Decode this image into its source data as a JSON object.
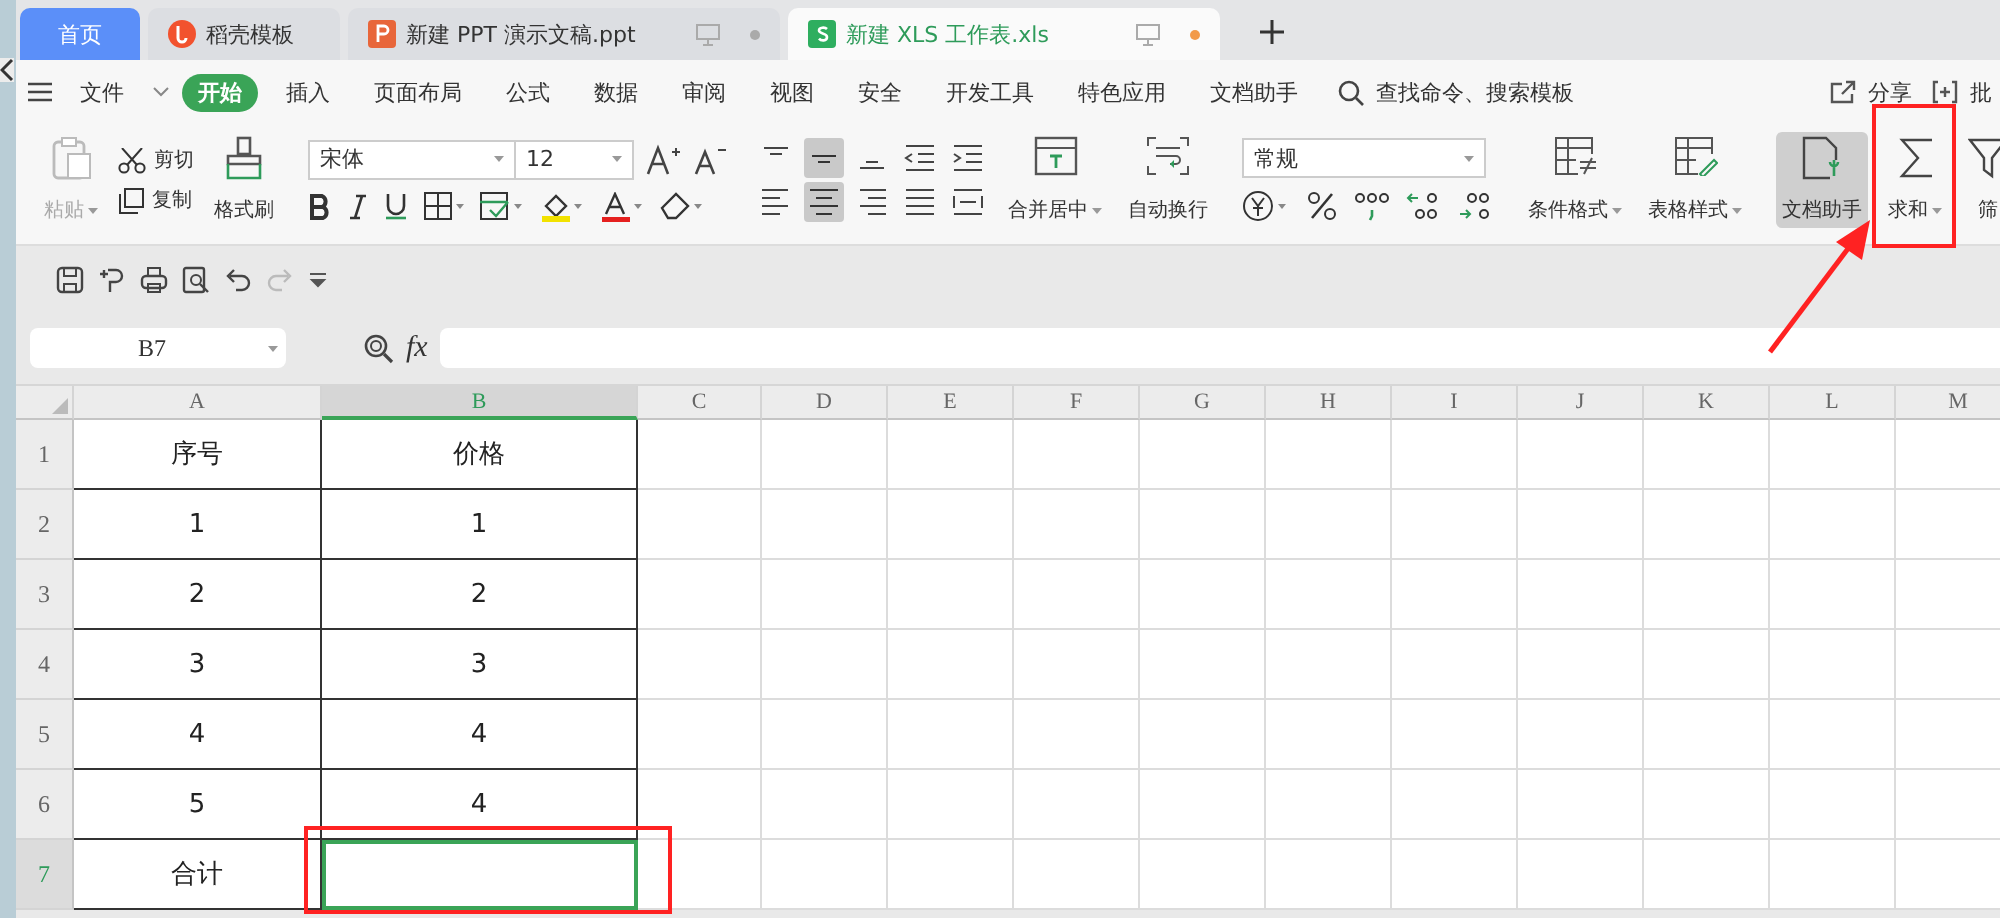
{
  "tabs": [
    {
      "label": "首页",
      "kind": "home",
      "selected": false
    },
    {
      "label": "稻壳模板",
      "kind": "docer",
      "selected": false
    },
    {
      "label": "新建 PPT 演示文稿.ppt",
      "kind": "ppt",
      "selected": false,
      "unsaved": false
    },
    {
      "label": "新建 XLS 工作表.xls",
      "kind": "xls",
      "selected": true,
      "unsaved": true
    }
  ],
  "menu": {
    "file": "文件",
    "items": [
      {
        "label": "开始",
        "selected": true
      },
      {
        "label": "插入",
        "selected": false
      },
      {
        "label": "页面布局",
        "selected": false
      },
      {
        "label": "公式",
        "selected": false
      },
      {
        "label": "数据",
        "selected": false
      },
      {
        "label": "审阅",
        "selected": false
      },
      {
        "label": "视图",
        "selected": false
      },
      {
        "label": "安全",
        "selected": false
      },
      {
        "label": "开发工具",
        "selected": false
      },
      {
        "label": "特色应用",
        "selected": false
      },
      {
        "label": "文档助手",
        "selected": false
      }
    ],
    "search": "查找命令、搜索模板",
    "share": "分享",
    "comment": "批"
  },
  "ribbon": {
    "paste": {
      "label": "粘贴",
      "disabled": true
    },
    "cut": "剪切",
    "copy": "复制",
    "format_painter": "格式刷",
    "font_name": "宋体",
    "font_size": "12",
    "merge": "合并居中",
    "wrap": "自动换行",
    "number_format": "常规",
    "conditional_format": "条件格式",
    "table_style": "表格样式",
    "doc_helper": {
      "label": "文档助手",
      "selected": true
    },
    "sum": "求和",
    "filter": "筛"
  },
  "name_box": "B7",
  "fx": "fx",
  "columns": [
    {
      "label": "A",
      "selected": false
    },
    {
      "label": "B",
      "selected": true
    },
    {
      "label": "C",
      "selected": false
    },
    {
      "label": "D",
      "selected": false
    },
    {
      "label": "E",
      "selected": false
    },
    {
      "label": "F",
      "selected": false
    },
    {
      "label": "G",
      "selected": false
    },
    {
      "label": "H",
      "selected": false
    },
    {
      "label": "I",
      "selected": false
    },
    {
      "label": "J",
      "selected": false
    },
    {
      "label": "K",
      "selected": false
    },
    {
      "label": "L",
      "selected": false
    },
    {
      "label": "M",
      "selected": false
    }
  ],
  "rows": [
    {
      "label": "1",
      "selected": false,
      "cells": [
        "序号",
        "价格"
      ]
    },
    {
      "label": "2",
      "selected": false,
      "cells": [
        "1",
        "1"
      ]
    },
    {
      "label": "3",
      "selected": false,
      "cells": [
        "2",
        "2"
      ]
    },
    {
      "label": "4",
      "selected": false,
      "cells": [
        "3",
        "3"
      ]
    },
    {
      "label": "5",
      "selected": false,
      "cells": [
        "4",
        "4"
      ]
    },
    {
      "label": "6",
      "selected": false,
      "cells": [
        "5",
        "4"
      ]
    },
    {
      "label": "7",
      "selected": true,
      "cells": [
        "合计",
        ""
      ]
    }
  ]
}
